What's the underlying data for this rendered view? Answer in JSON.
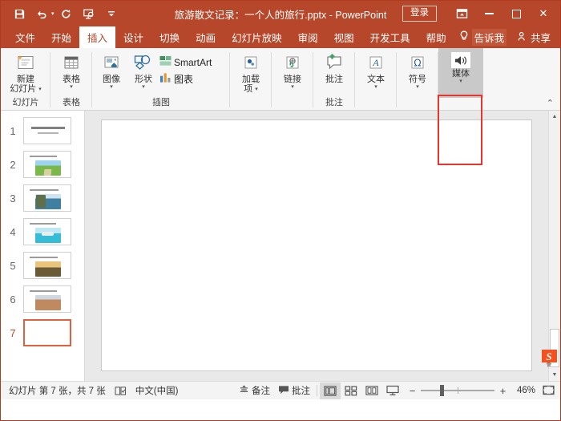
{
  "titlebar": {
    "document_title": "旅游散文记录：一个人的旅行.pptx  -  PowerPoint",
    "quick_access": [
      {
        "name": "save-icon",
        "label": "保存"
      },
      {
        "name": "undo-icon",
        "label": "撤消"
      },
      {
        "name": "redo-icon",
        "label": "重复"
      },
      {
        "name": "start-slideshow-icon",
        "label": "从头开始"
      },
      {
        "name": "customize-qat-icon",
        "label": "自定义快速访问工具栏"
      }
    ],
    "signin_label": "登录",
    "ribbon_display_label": "功能区显示选项",
    "minimize_label": "最小化",
    "maximize_label": "最大化",
    "close_label": "关闭"
  },
  "tabs": [
    {
      "label": "文件",
      "active": false
    },
    {
      "label": "开始",
      "active": false
    },
    {
      "label": "插入",
      "active": true
    },
    {
      "label": "设计",
      "active": false
    },
    {
      "label": "切换",
      "active": false
    },
    {
      "label": "动画",
      "active": false
    },
    {
      "label": "幻灯片放映",
      "active": false
    },
    {
      "label": "审阅",
      "active": false
    },
    {
      "label": "视图",
      "active": false
    },
    {
      "label": "开发工具",
      "active": false
    },
    {
      "label": "帮助",
      "active": false
    }
  ],
  "tellme_label": "告诉我",
  "share_label": "共享",
  "ribbon": {
    "collapse_label": "折叠功能区",
    "groups": [
      {
        "group_label": "幻灯片",
        "buttons": [
          {
            "name": "new-slide-button",
            "line1": "新建",
            "line2": "幻灯片",
            "has_caret": true,
            "icon": "new-slide-icon"
          }
        ]
      },
      {
        "group_label": "表格",
        "buttons": [
          {
            "name": "table-button",
            "line1": "表格",
            "line2": "",
            "has_caret": true,
            "icon": "table-icon"
          }
        ]
      },
      {
        "group_label": "插图",
        "buttons": [
          {
            "name": "images-button",
            "line1": "图像",
            "line2": "",
            "has_caret": true,
            "icon": "images-icon"
          },
          {
            "name": "shapes-button",
            "line1": "形状",
            "line2": "",
            "has_caret": true,
            "icon": "shapes-icon"
          },
          {
            "name": "smartart-button",
            "line1": "SmartArt",
            "line2": "",
            "has_caret": false,
            "icon": "smartart-icon"
          },
          {
            "name": "chart-button",
            "line1": "图表",
            "line2": "",
            "has_caret": false,
            "icon": "chart-icon"
          }
        ]
      },
      {
        "group_label": "",
        "buttons": [
          {
            "name": "addins-button",
            "line1": "加载",
            "line2": "项",
            "has_caret": true,
            "icon": "addins-icon"
          }
        ]
      },
      {
        "group_label": "",
        "buttons": [
          {
            "name": "link-button",
            "line1": "链接",
            "line2": "",
            "has_caret": true,
            "icon": "link-icon"
          }
        ]
      },
      {
        "group_label": "批注",
        "buttons": [
          {
            "name": "comment-button",
            "line1": "批注",
            "line2": "",
            "has_caret": false,
            "icon": "comment-icon"
          }
        ]
      },
      {
        "group_label": "",
        "buttons": [
          {
            "name": "text-button",
            "line1": "文本",
            "line2": "",
            "has_caret": true,
            "icon": "text-icon"
          }
        ]
      },
      {
        "group_label": "",
        "buttons": [
          {
            "name": "symbol-button",
            "line1": "符号",
            "line2": "",
            "has_caret": true,
            "icon": "symbol-icon"
          }
        ]
      },
      {
        "group_label": "",
        "buttons": [
          {
            "name": "media-button",
            "line1": "媒体",
            "line2": "",
            "has_caret": true,
            "icon": "media-icon",
            "highlighted": true
          }
        ]
      }
    ]
  },
  "thumbnails": [
    {
      "number": "1",
      "selected": false,
      "layout": "title",
      "img": null
    },
    {
      "number": "2",
      "selected": false,
      "layout": "text-image",
      "img": "#6aa84f"
    },
    {
      "number": "3",
      "selected": false,
      "layout": "text-image",
      "img": "#5b7f8f"
    },
    {
      "number": "4",
      "selected": false,
      "layout": "text-image",
      "img": "#49c4d8"
    },
    {
      "number": "5",
      "selected": false,
      "layout": "text-image",
      "img": "#8a6a3a"
    },
    {
      "number": "6",
      "selected": false,
      "layout": "text-image",
      "img": "#b08060"
    },
    {
      "number": "7",
      "selected": true,
      "layout": "blank",
      "img": null
    }
  ],
  "statusbar": {
    "slide_info": "幻灯片 第 7 张，共 7 张",
    "accessibility_label": "辅助功能检查器",
    "language": "中文(中国)",
    "notes_label": "备注",
    "comments_label": "批注",
    "views": [
      {
        "name": "normal-view-button",
        "label": "普通视图",
        "active": true
      },
      {
        "name": "slide-sorter-button",
        "label": "幻灯片浏览",
        "active": false
      },
      {
        "name": "reading-view-button",
        "label": "阅读视图",
        "active": false
      },
      {
        "name": "slideshow-button",
        "label": "幻灯片放映",
        "active": false
      }
    ],
    "zoom_out_label": "缩小",
    "zoom_in_label": "放大",
    "zoom_value": "46%",
    "fit_label": "使幻灯片适应当前窗口"
  },
  "colors": {
    "accent": "#b7472a",
    "highlight": "#e8352b",
    "selected_thumb": "#e1603e"
  }
}
